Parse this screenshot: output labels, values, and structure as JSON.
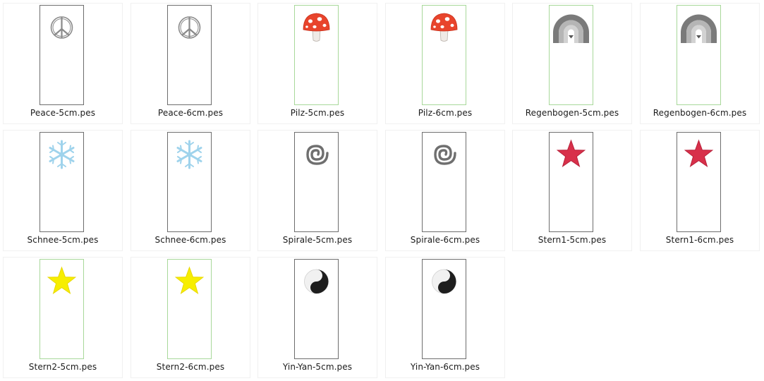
{
  "window": {
    "view": "Große Symbole"
  },
  "files": [
    {
      "name": "Peace-5cm.pes",
      "icon": "peace-icon",
      "frame": "gray",
      "color": "#8a8a8a"
    },
    {
      "name": "Peace-6cm.pes",
      "icon": "peace-icon",
      "frame": "gray",
      "color": "#8a8a8a"
    },
    {
      "name": "Pilz-5cm.pes",
      "icon": "mushroom-icon",
      "frame": "green",
      "color": "#e8442c"
    },
    {
      "name": "Pilz-6cm.pes",
      "icon": "mushroom-icon",
      "frame": "green",
      "color": "#e8442c"
    },
    {
      "name": "Regenbogen-5cm.pes",
      "icon": "rainbow-icon",
      "frame": "green",
      "color": "#7a7a7a"
    },
    {
      "name": "Regenbogen-6cm.pes",
      "icon": "rainbow-icon",
      "frame": "green",
      "color": "#7a7a7a"
    },
    {
      "name": "Schnee-5cm.pes",
      "icon": "snowflake-icon",
      "frame": "gray",
      "color": "#9fd3ec"
    },
    {
      "name": "Schnee-6cm.pes",
      "icon": "snowflake-icon",
      "frame": "gray",
      "color": "#9fd3ec"
    },
    {
      "name": "Spirale-5cm.pes",
      "icon": "spiral-icon",
      "frame": "gray",
      "color": "#6f6f6f"
    },
    {
      "name": "Spirale-6cm.pes",
      "icon": "spiral-icon",
      "frame": "gray",
      "color": "#6f6f6f"
    },
    {
      "name": "Stern1-5cm.pes",
      "icon": "star-icon",
      "frame": "gray",
      "color": "#d8304a"
    },
    {
      "name": "Stern1-6cm.pes",
      "icon": "star-icon",
      "frame": "gray",
      "color": "#d8304a"
    },
    {
      "name": "Stern2-5cm.pes",
      "icon": "star-icon",
      "frame": "green",
      "color": "#f7ee00"
    },
    {
      "name": "Stern2-6cm.pes",
      "icon": "star-icon",
      "frame": "green",
      "color": "#f7ee00"
    },
    {
      "name": "Yin-Yan-5cm.pes",
      "icon": "yin-yang-icon",
      "frame": "gray",
      "color": "#1e1e1e"
    },
    {
      "name": "Yin-Yan-6cm.pes",
      "icon": "yin-yang-icon",
      "frame": "gray",
      "color": "#1e1e1e"
    }
  ]
}
